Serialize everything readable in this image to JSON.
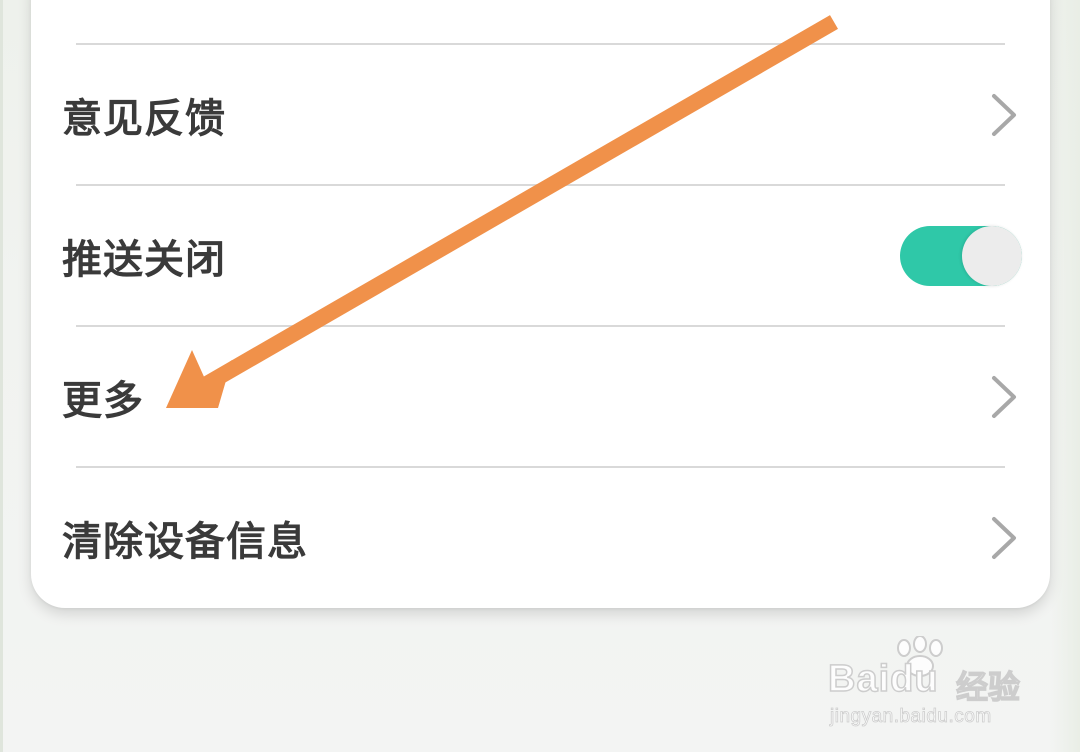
{
  "settings": {
    "items": [
      {
        "label": "意见反馈",
        "control": "chevron-right"
      },
      {
        "label": "推送关闭",
        "control": "toggle",
        "toggle_on": true
      },
      {
        "label": "更多",
        "control": "chevron-right"
      },
      {
        "label": "清除设备信息",
        "control": "chevron-right"
      }
    ]
  },
  "colors": {
    "toggle_track": "#2fc8a8",
    "toggle_knob": "#ececec",
    "annotation_arrow": "#f0914a",
    "label_text": "#3a3a3a",
    "chevron": "#a8a8a8"
  },
  "watermark": {
    "brand": "Bai",
    "brand_2": "du",
    "suffix": "经验",
    "url": "jingyan.baidu.com"
  }
}
